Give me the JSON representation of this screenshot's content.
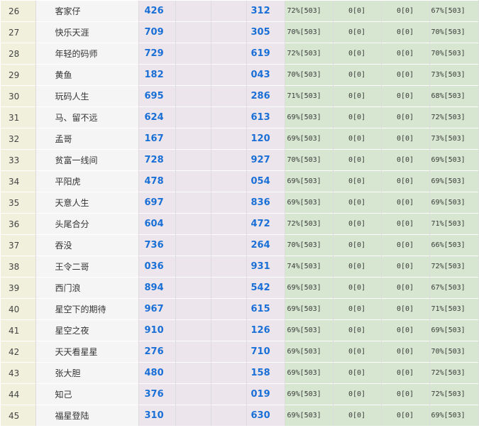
{
  "rows": [
    {
      "rank": "26",
      "name": "客家仔",
      "n1": "426",
      "n2": "312",
      "p1": "72%[503]",
      "z1": "0[0]",
      "z2": "0[0]",
      "p2": "67%[503]"
    },
    {
      "rank": "27",
      "name": "快乐天涯",
      "n1": "709",
      "n2": "305",
      "p1": "70%[503]",
      "z1": "0[0]",
      "z2": "0[0]",
      "p2": "70%[503]"
    },
    {
      "rank": "28",
      "name": "年轻的码师",
      "n1": "729",
      "n2": "619",
      "p1": "72%[503]",
      "z1": "0[0]",
      "z2": "0[0]",
      "p2": "70%[503]"
    },
    {
      "rank": "29",
      "name": "黄鱼",
      "n1": "182",
      "n2": "043",
      "p1": "70%[503]",
      "z1": "0[0]",
      "z2": "0[0]",
      "p2": "73%[503]"
    },
    {
      "rank": "30",
      "name": "玩码人生",
      "n1": "695",
      "n2": "286",
      "p1": "71%[503]",
      "z1": "0[0]",
      "z2": "0[0]",
      "p2": "68%[503]"
    },
    {
      "rank": "31",
      "name": "马、留不远",
      "n1": "624",
      "n2": "613",
      "p1": "69%[503]",
      "z1": "0[0]",
      "z2": "0[0]",
      "p2": "72%[503]"
    },
    {
      "rank": "32",
      "name": "孟哥",
      "n1": "167",
      "n2": "120",
      "p1": "69%[503]",
      "z1": "0[0]",
      "z2": "0[0]",
      "p2": "73%[503]"
    },
    {
      "rank": "33",
      "name": "贫富一线间",
      "n1": "728",
      "n2": "927",
      "p1": "70%[503]",
      "z1": "0[0]",
      "z2": "0[0]",
      "p2": "69%[503]"
    },
    {
      "rank": "34",
      "name": "平阳虎",
      "n1": "478",
      "n2": "054",
      "p1": "69%[503]",
      "z1": "0[0]",
      "z2": "0[0]",
      "p2": "69%[503]"
    },
    {
      "rank": "35",
      "name": "天意人生",
      "n1": "697",
      "n2": "836",
      "p1": "69%[503]",
      "z1": "0[0]",
      "z2": "0[0]",
      "p2": "69%[503]"
    },
    {
      "rank": "36",
      "name": "头尾合分",
      "n1": "604",
      "n2": "472",
      "p1": "72%[503]",
      "z1": "0[0]",
      "z2": "0[0]",
      "p2": "71%[503]"
    },
    {
      "rank": "37",
      "name": "吞没",
      "n1": "736",
      "n2": "264",
      "p1": "70%[503]",
      "z1": "0[0]",
      "z2": "0[0]",
      "p2": "66%[503]"
    },
    {
      "rank": "38",
      "name": "王令二哥",
      "n1": "036",
      "n2": "931",
      "p1": "74%[503]",
      "z1": "0[0]",
      "z2": "0[0]",
      "p2": "72%[503]"
    },
    {
      "rank": "39",
      "name": "西门浪",
      "n1": "894",
      "n2": "542",
      "p1": "69%[503]",
      "z1": "0[0]",
      "z2": "0[0]",
      "p2": "67%[503]"
    },
    {
      "rank": "40",
      "name": "星空下的期待",
      "n1": "967",
      "n2": "615",
      "p1": "69%[503]",
      "z1": "0[0]",
      "z2": "0[0]",
      "p2": "71%[503]"
    },
    {
      "rank": "41",
      "name": "星空之夜",
      "n1": "910",
      "n2": "126",
      "p1": "69%[503]",
      "z1": "0[0]",
      "z2": "0[0]",
      "p2": "69%[503]"
    },
    {
      "rank": "42",
      "name": "天天看星星",
      "n1": "276",
      "n2": "710",
      "p1": "69%[503]",
      "z1": "0[0]",
      "z2": "0[0]",
      "p2": "70%[503]"
    },
    {
      "rank": "43",
      "name": "张大胆",
      "n1": "480",
      "n2": "158",
      "p1": "69%[503]",
      "z1": "0[0]",
      "z2": "0[0]",
      "p2": "72%[503]"
    },
    {
      "rank": "44",
      "name": "知己",
      "n1": "376",
      "n2": "019",
      "p1": "69%[503]",
      "z1": "0[0]",
      "z2": "0[0]",
      "p2": "72%[503]"
    },
    {
      "rank": "45",
      "name": "福星登陆",
      "n1": "310",
      "n2": "630",
      "p1": "69%[503]",
      "z1": "0[0]",
      "z2": "0[0]",
      "p2": "69%[503]"
    }
  ],
  "colors": {
    "rank_bg": "#f0f0dc",
    "name_bg": "#f5f5f5",
    "number_bg": "#ece6ec",
    "number_text": "#1a6fd6",
    "stat_bg": "#d6e6d0"
  }
}
